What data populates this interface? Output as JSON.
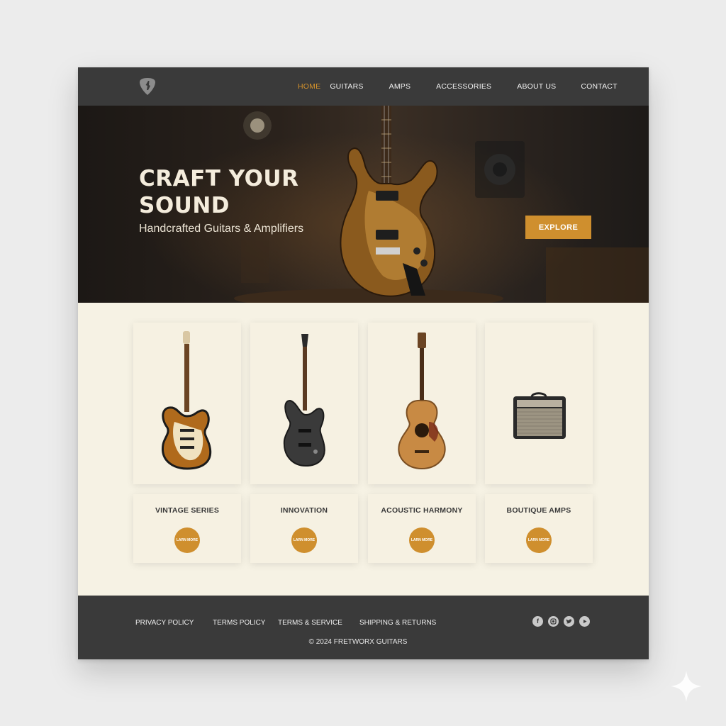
{
  "nav": {
    "items": [
      {
        "label": "HOME",
        "active": true
      },
      {
        "label": "GUITARS",
        "active": false
      },
      {
        "label": "AMPS",
        "active": false
      },
      {
        "label": "ACCESSORIES",
        "active": false
      },
      {
        "label": "ABOUT US",
        "active": false
      },
      {
        "label": "CONTACT",
        "active": false
      }
    ],
    "logo_icon": "guitar-pick-icon"
  },
  "hero": {
    "title": "CRAFT YOUR SOUND",
    "subtitle": "Handcrafted Guitars & Amplifiers",
    "cta_label": "EXPLORE"
  },
  "products": [
    {
      "title": "VINTAGE SERIES",
      "button": "LARN MORE",
      "image_icon": "sunburst-electric-guitar-icon"
    },
    {
      "title": "INNOVATION",
      "button": "LARN MORE",
      "image_icon": "black-electric-guitar-icon"
    },
    {
      "title": "ACOUSTIC HARMONY",
      "button": "LARN MORE",
      "image_icon": "acoustic-guitar-icon"
    },
    {
      "title": "BOUTIQUE AMPS",
      "button": "LARN MORE",
      "image_icon": "guitar-amp-icon"
    }
  ],
  "footer": {
    "links": [
      "PRIVACY POLICY",
      "TERMS POLICY",
      "TERMS & SERVICE",
      "SHIPPING & RETURNS"
    ],
    "copyright": "© 2024 FRETWORX GUITARS",
    "social": [
      "facebook-icon",
      "instagram-icon",
      "twitter-icon",
      "youtube-icon"
    ]
  },
  "colors": {
    "accent": "#cf8f2e",
    "nav_bg": "#3a3a3a",
    "content_bg": "#f6f2e4"
  }
}
